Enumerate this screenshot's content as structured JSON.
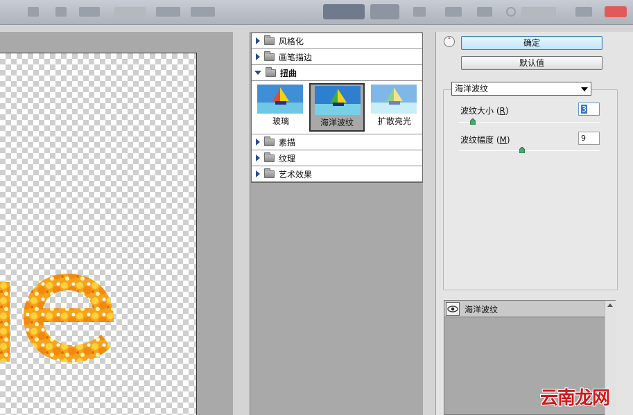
{
  "filter_gallery": {
    "categories": [
      {
        "label": "风格化",
        "expanded": false
      },
      {
        "label": "画笔描边",
        "expanded": false
      },
      {
        "label": "扭曲",
        "expanded": true
      },
      {
        "label": "素描",
        "expanded": false
      },
      {
        "label": "纹理",
        "expanded": false
      },
      {
        "label": "艺术效果",
        "expanded": false
      }
    ],
    "distort_filters": [
      {
        "label": "玻璃",
        "selected": false
      },
      {
        "label": "海洋波纹",
        "selected": true
      },
      {
        "label": "扩散亮光",
        "selected": false
      }
    ]
  },
  "actions": {
    "ok_label": "确定",
    "default_label": "默认值"
  },
  "settings": {
    "selected_filter": "海洋波纹",
    "ripple_size": {
      "label": "波纹大小",
      "mnemonic": "R",
      "value": "3",
      "slider_fraction": 0.1
    },
    "ripple_magnitude": {
      "label": "波纹幅度",
      "mnemonic": "M",
      "value": "9",
      "slider_fraction": 0.45
    }
  },
  "effect_layers": [
    {
      "label": "海洋波纹",
      "visible": true
    }
  ],
  "watermark": "云南龙网",
  "colors": {
    "accent_blue": "#3c7fb1",
    "panel_gray": "#a9a9a9",
    "text_orange": "#f5a21a"
  }
}
